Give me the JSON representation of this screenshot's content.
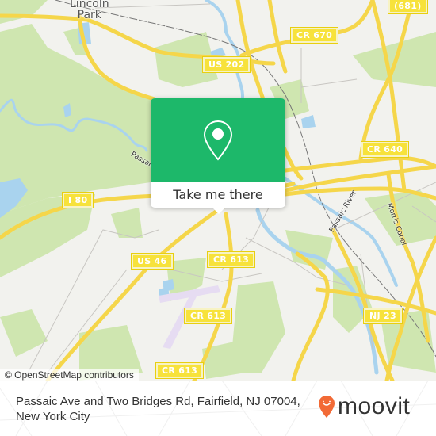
{
  "map": {
    "place_labels": [
      {
        "id": "lincoln-park",
        "text": "Lincoln\nPark"
      }
    ],
    "road_shields": [
      {
        "id": "cr-681",
        "text": "(681)"
      },
      {
        "id": "cr-670",
        "text": "CR 670"
      },
      {
        "id": "us-202",
        "text": "US 202"
      },
      {
        "id": "cr-640",
        "text": "CR 640"
      },
      {
        "id": "i-80",
        "text": "I 80"
      },
      {
        "id": "us-46",
        "text": "US 46"
      },
      {
        "id": "cr-613-a",
        "text": "CR 613"
      },
      {
        "id": "cr-613-b",
        "text": "CR 613"
      },
      {
        "id": "cr-613-c",
        "text": "CR 613"
      },
      {
        "id": "nj-23",
        "text": "NJ 23"
      }
    ],
    "water_labels": [
      {
        "id": "passaic-river",
        "text": "Passaic River"
      },
      {
        "id": "morris-canal",
        "text": "Morris Canal"
      },
      {
        "id": "passaic-west",
        "text": "Passaic"
      }
    ],
    "attribution": "© OpenStreetMap contributors"
  },
  "popup": {
    "icon": "map-pin-icon",
    "button_label": "Take me there",
    "color": "#1db86a"
  },
  "footer": {
    "address": "Passaic Ave and Two Bridges Rd, Fairfield, NJ 07004, New York City",
    "logo_text": "moovit",
    "logo_icon": "moovit-pin-icon",
    "logo_color": "#f26a36"
  }
}
